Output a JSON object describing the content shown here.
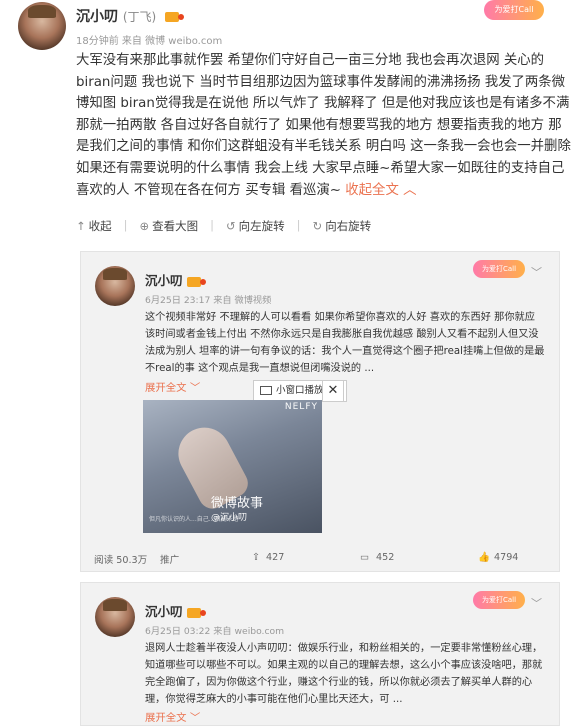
{
  "post": {
    "user_name": "沉小叨",
    "user_tag": "(丁飞)",
    "meta": "18分钟前  来自 微博 weibo.com",
    "text": "大军没有来那此事就作罢 希望你们守好自己一亩三分地 我也会再次退网 关心的biran问题 我也说下 当时节目组那边因为篮球事件发酵闹的沸沸扬扬 我发了两条微博知图 biran觉得我是在说他 所以气炸了 我解释了 但是他对我应该也是有诸多不满 那就一拍两散 各自过好各自就行了 如果他有想要骂我的地方 想要指责我的地方 那是我们之间的事情 和你们这群蛆没有半毛钱关系 明白吗 这一条我一会也会一并删除 如果还有需要说明的什么事情 我会上线 大家早点睡~希望大家一如既往的支持自己喜欢的人 不管现在各在何方 买专辑 看巡演~ ",
    "collapse_label": "收起全文",
    "actions": [
      {
        "icon": "collapse-icon",
        "glyph": "↑",
        "label": "收起"
      },
      {
        "icon": "zoom-icon",
        "glyph": "⊕",
        "label": "查看大图"
      },
      {
        "icon": "rotate-left-icon",
        "glyph": "↺",
        "label": "向左旋转"
      },
      {
        "icon": "rotate-right-icon",
        "glyph": "↻",
        "label": "向右旋转"
      }
    ]
  },
  "card1": {
    "user_name": "沉小叨",
    "meta": "6月25日 23:17 来自 微博视频",
    "text": "这个视频非常好 不理解的人可以看看 如果你希望你喜欢的人好 喜欢的东西好 那你就应该时间或者金钱上付出 不然你永远只是自我膨胀自我优越感 酸别人又看不起别人但又没法成为别人 坦率的讲一句有争议的话：我个人一直觉得这个圈子把real挂嘴上但做的是最不real的事 这个观点是我一直想说但闭嘴没说的 ...",
    "expand_label": "展开全文",
    "popup_label": "小窗口播放",
    "video_brand": "微博故事",
    "video_user": "@沉小叨",
    "video_caption": "但凡你认识的人...自己...西藏卡路",
    "video_watermark": "NELFY",
    "stats": {
      "views": "阅读 50.3万",
      "promote": "推广",
      "shares": "427",
      "comments": "452",
      "likes": "4794"
    }
  },
  "card2": {
    "user_name": "沉小叨",
    "meta": "6月25日 03:22 来自 weibo.com",
    "text": "退网人士趁着半夜没人小声叨叨：做娱乐行业，和粉丝相关的，一定要非常懂粉丝心理，知道哪些可以哪些不可以。如果主观的以自己的理解去想，这么小个事应该没啥吧，那就完全跑偏了，因为你做这个行业，赚这个行业的钱，所以你就必须去了解买单人群的心理，你觉得芝麻大的小事可能在他们心里比天还大，可 ...",
    "expand_label": "展开全文"
  },
  "ribbon_text": "为爱打Call",
  "colors": {
    "accent": "#eb7350",
    "card_bg": "#f2f2f2"
  }
}
